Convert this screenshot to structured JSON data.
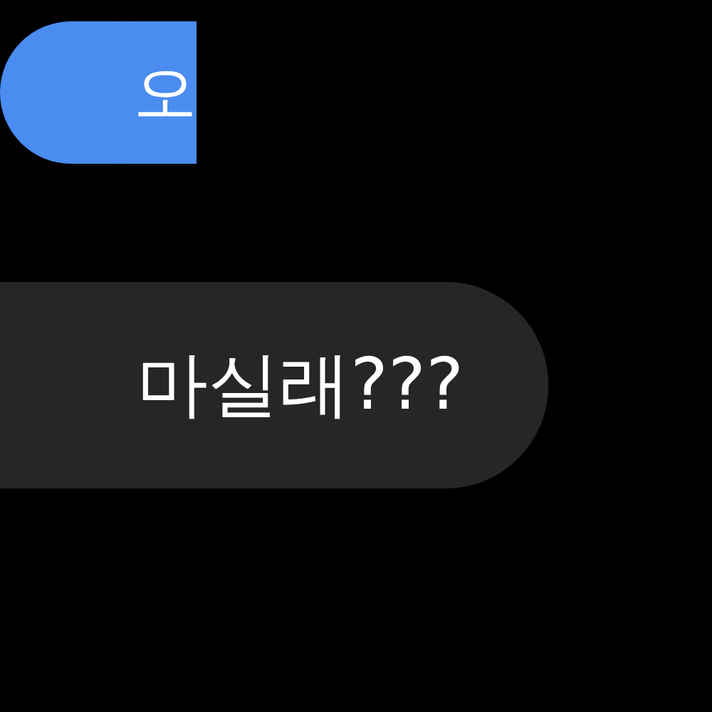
{
  "messages": [
    {
      "kind": "sent",
      "text": "오"
    },
    {
      "kind": "received",
      "text": "마실래???"
    }
  ]
}
